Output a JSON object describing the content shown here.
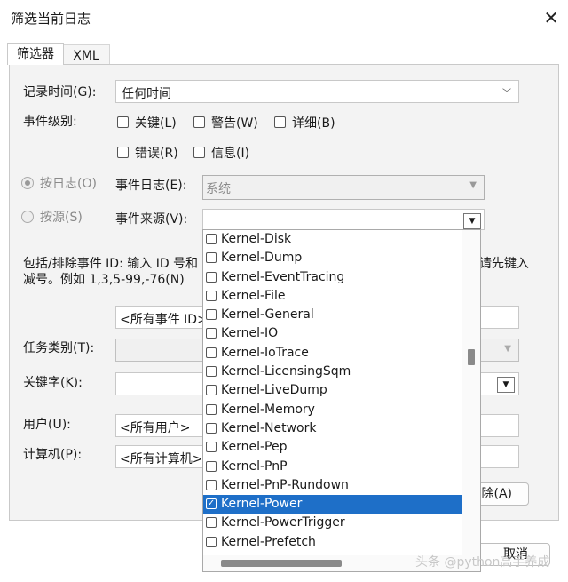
{
  "window": {
    "title": "筛选当前日志",
    "close_icon": "close-icon"
  },
  "tabs": [
    {
      "label": "筛选器"
    },
    {
      "label": "XML"
    }
  ],
  "logged": {
    "label": "记录时间(G):",
    "value": "任何时间"
  },
  "event_level": {
    "label": "事件级别:",
    "critical": "关键(L)",
    "warning": "警告(W)",
    "verbose": "详细(B)",
    "error": "错误(R)",
    "information": "信息(I)"
  },
  "by_log": {
    "label": "按日志(O)",
    "selected": true
  },
  "by_source": {
    "label": "按源(S)",
    "selected": false
  },
  "event_logs": {
    "label": "事件日志(E):",
    "value": "系统"
  },
  "event_sources": {
    "label": "事件来源(V):",
    "value": ""
  },
  "event_id": {
    "desc_prefix": "包括/排除事件 ID: 输入 ID 号和",
    "desc_suffix": "请先键入",
    "desc_line2": "减号。例如 1,3,5-99,-76(N)",
    "value": "<所有事件 ID>"
  },
  "task_category": {
    "label": "任务类别(T):"
  },
  "keywords": {
    "label": "关键字(K):"
  },
  "user": {
    "label": "用户(U):",
    "value": "<所有用户>"
  },
  "computer": {
    "label": "计算机(P):",
    "value": "<所有计算机>"
  },
  "buttons": {
    "clear": "除(A)",
    "cancel": "取消"
  },
  "source_list": [
    {
      "name": "Kernel-Disk",
      "checked": false
    },
    {
      "name": "Kernel-Dump",
      "checked": false
    },
    {
      "name": "Kernel-EventTracing",
      "checked": false
    },
    {
      "name": "Kernel-File",
      "checked": false
    },
    {
      "name": "Kernel-General",
      "checked": false
    },
    {
      "name": "Kernel-IO",
      "checked": false
    },
    {
      "name": "Kernel-IoTrace",
      "checked": false
    },
    {
      "name": "Kernel-LicensingSqm",
      "checked": false
    },
    {
      "name": "Kernel-LiveDump",
      "checked": false
    },
    {
      "name": "Kernel-Memory",
      "checked": false
    },
    {
      "name": "Kernel-Network",
      "checked": false
    },
    {
      "name": "Kernel-Pep",
      "checked": false
    },
    {
      "name": "Kernel-PnP",
      "checked": false
    },
    {
      "name": "Kernel-PnP-Rundown",
      "checked": false
    },
    {
      "name": "Kernel-Power",
      "checked": true
    },
    {
      "name": "Kernel-PowerTrigger",
      "checked": false
    },
    {
      "name": "Kernel-Prefetch",
      "checked": false
    }
  ],
  "watermark": "头条 @python高手养成",
  "colors": {
    "selection": "#1e6fc8",
    "panel": "#f3f3f3"
  }
}
